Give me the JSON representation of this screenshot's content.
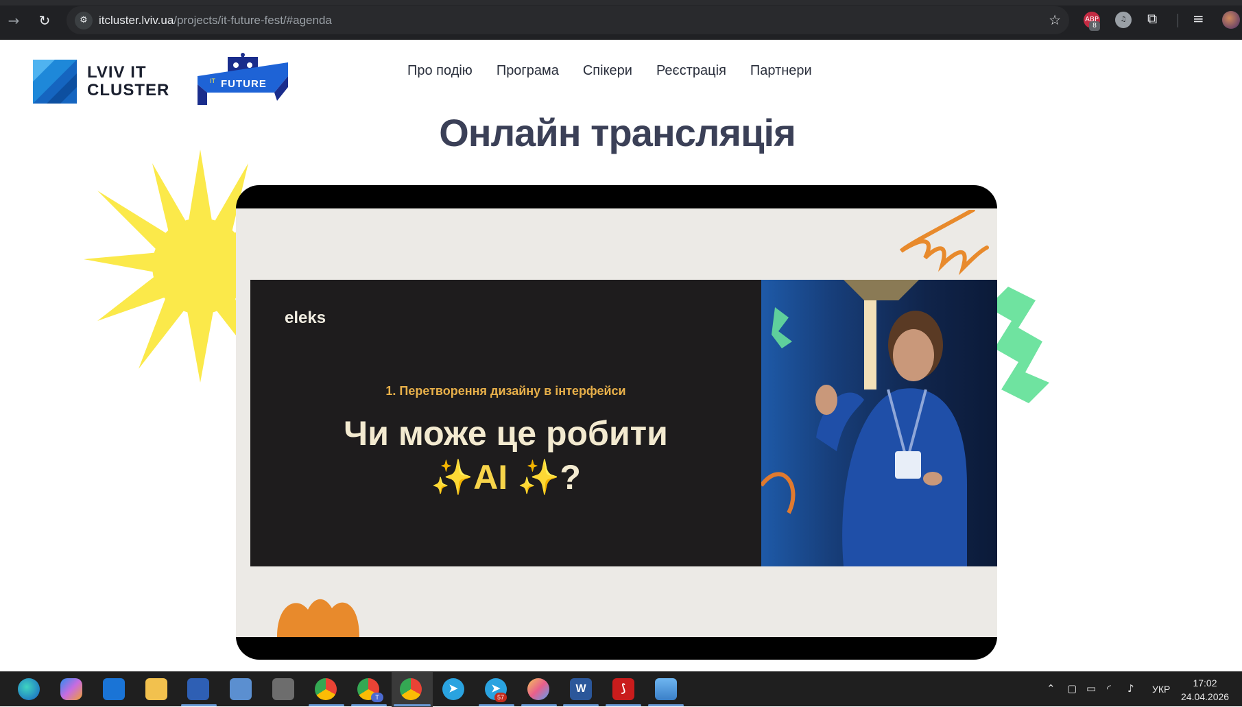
{
  "browser": {
    "url_host": "itcluster.lviv.ua",
    "url_path": "/projects/it-future-fest/#agenda",
    "icons": {
      "back": "arrow-right-icon",
      "reload": "reload-icon",
      "site_info": "site-info-icon",
      "bookmark": "star-icon",
      "extensions": "puzzle-icon",
      "reading_list": "media-control-icon",
      "profile": "profile-icon"
    },
    "ext_adblock_label": "ABP",
    "ext_adblock_badge": "8"
  },
  "site": {
    "logo_text_line1": "LVIV IT",
    "logo_text_line2": "CLUSTER",
    "future_logo_small": "IT",
    "future_logo_text": "FUTURE",
    "nav": [
      "Про подію",
      "Програма",
      "Спікери",
      "Реєстрація",
      "Партнери"
    ],
    "section_title": "Онлайн трансляція"
  },
  "video": {
    "slide_brand": "eleks",
    "slide_subtitle": "1. Перетворення дизайну в інтерфейси",
    "slide_headline_line1": "Чи може це робити",
    "slide_headline_line2_pre": "✨AI ✨",
    "slide_headline_line2_post": "?"
  },
  "taskbar": {
    "apps": [
      "edge",
      "copilot",
      "outlook",
      "file-explorer",
      "save",
      "remote-desktop",
      "calculator",
      "chrome",
      "chrome",
      "chrome",
      "telegram",
      "telegram",
      "paint",
      "word",
      "acrobat",
      "photos"
    ],
    "telegram_badge": "57",
    "chrome_badge": "T",
    "word_label": "W",
    "language": "УКР",
    "time": "17:02",
    "date": "24.04.2026"
  },
  "colors": {
    "title": "#3b4057",
    "brand_blue": "#1e6fd9",
    "sun": "#fbe94a",
    "green_deco": "#6fe3a0",
    "orange_deco": "#e88a2c"
  }
}
